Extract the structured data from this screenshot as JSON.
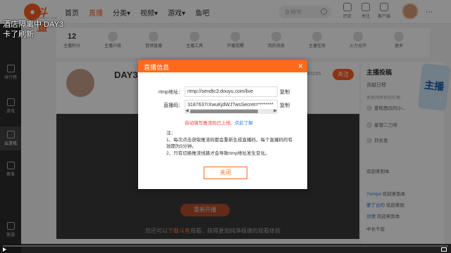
{
  "caption": {
    "line1": "酒店隔离中 DAY3",
    "line2": "卡了刷新"
  },
  "topbar": {
    "logo_text": "斗鱼",
    "logo_sub": "DOUYU.COM",
    "nav": [
      "首页",
      "直播",
      "分类▾",
      "视频▾",
      "游戏▾",
      "鱼吧"
    ],
    "active_nav": "直播",
    "search_placeholder": "女神节",
    "icons": [
      {
        "icon": "history-icon",
        "label": "历史"
      },
      {
        "icon": "follow-icon",
        "label": "关注"
      },
      {
        "icon": "client-icon",
        "label": "客户端"
      }
    ]
  },
  "leftbar": {
    "items": [
      {
        "icon": "rank-icon",
        "label": "排行榜"
      },
      {
        "icon": "game-icon",
        "label": "游戏"
      },
      {
        "icon": "cloud-game-icon",
        "label": "云游戏"
      },
      {
        "icon": "trophy-icon",
        "label": "赛事"
      },
      {
        "icon": "message-icon",
        "label": "客服"
      }
    ]
  },
  "infobar": {
    "items": [
      {
        "value": "12",
        "label": "主播积分"
      },
      {
        "value": "",
        "label": "主播升级"
      },
      {
        "value": "",
        "label": "音频直播"
      },
      {
        "value": "",
        "label": "主播工具"
      },
      {
        "value": "",
        "label": "开播提醒"
      },
      {
        "value": "",
        "label": "我的消息"
      },
      {
        "value": "",
        "label": "主播任务"
      },
      {
        "value": "",
        "label": "火力全开"
      },
      {
        "value": "",
        "label": "更多"
      }
    ]
  },
  "streamer": {
    "title": "DAY3 真",
    "fans": "43185",
    "follow": "关注"
  },
  "stage": {
    "start_button": "重新开播",
    "hint_prefix": "您还可以",
    "hint_link": "下载斗鱼",
    "hint_suffix": "观看，获得更加纯净极速的观看体验"
  },
  "rightpanel": {
    "title": "主播投稿",
    "tab": "贡献日榜",
    "sub": "本房间所有的礼物",
    "chat": [
      {
        "name": "",
        "text": "爱吃西瓜的小..."
      },
      {
        "name": "",
        "text": "星宿二三呀"
      },
      {
        "name": "",
        "text": "刘长发"
      },
      {
        "name": "",
        "text": "欢迎来到本"
      },
      {
        "name": "7omiye",
        "text": "欢迎来到本"
      },
      {
        "name": "蒙了古的",
        "text": "欢迎来到"
      },
      {
        "name": "你猜",
        "text": "欢迎来到本"
      },
      {
        "name": "",
        "text": "中长千层"
      }
    ]
  },
  "dialog": {
    "title": "直播信息",
    "rtmp_label": "rtmp地址：",
    "rtmp_value": "rtmp://sendtc3.douyu.com/live",
    "code_label": "直播码：",
    "code_value": "3187637rXwuKjdWJ?wsSecret=********",
    "copy_label": "复制",
    "tip": "自动填写推流码已上线,",
    "tip_link": "点此了解",
    "notes_title": "注：",
    "note1": "1、每次点击获取推流码都会重新生成直播码，每个直播码的有效期为5分钟。",
    "note2": "2、只有切换推流线路才会导致rtmp地址发生变化。",
    "close_button": "关闭"
  }
}
